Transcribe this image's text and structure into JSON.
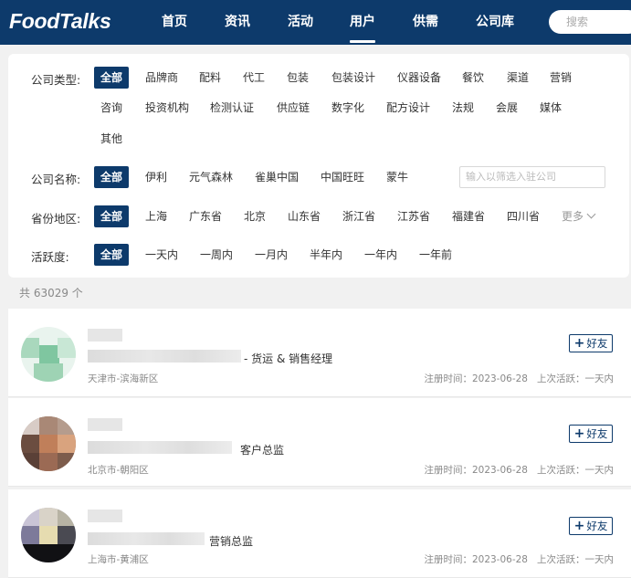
{
  "header": {
    "logo": "FoodTalks",
    "nav": [
      "首页",
      "资讯",
      "活动",
      "用户",
      "供需",
      "公司库"
    ],
    "active_nav": "用户",
    "search_placeholder": "搜索"
  },
  "filters": {
    "company_type": {
      "label": "公司类型:",
      "options": [
        "全部",
        "品牌商",
        "配料",
        "代工",
        "包装",
        "包装设计",
        "仪器设备",
        "餐饮",
        "渠道",
        "营销",
        "咨询",
        "投资机构",
        "检测认证",
        "供应链",
        "数字化",
        "配方设计",
        "法规",
        "会展",
        "媒体",
        "其他"
      ],
      "selected": "全部"
    },
    "company_name": {
      "label": "公司名称:",
      "options": [
        "全部",
        "伊利",
        "元气森林",
        "雀巢中国",
        "中国旺旺",
        "蒙牛"
      ],
      "selected": "全部",
      "input_placeholder": "输入以筛选入驻公司"
    },
    "province": {
      "label": "省份地区:",
      "options": [
        "全部",
        "上海",
        "广东省",
        "北京",
        "山东省",
        "浙江省",
        "江苏省",
        "福建省",
        "四川省"
      ],
      "selected": "全部",
      "more_label": "更多"
    },
    "activity": {
      "label": "活跃度:",
      "options": [
        "全部",
        "一天内",
        "一周内",
        "一月内",
        "半年内",
        "一年内",
        "一年前"
      ],
      "selected": "全部"
    }
  },
  "total_text": "共 63029 个",
  "users": [
    {
      "title": "- 货运 & 销售经理",
      "location": "天津市-滨海新区",
      "registered": "注册时间：2023-06-28",
      "last_active": "上次活跃：一天内",
      "friend_label": "好友"
    },
    {
      "title": "客户总监",
      "location": "北京市-朝阳区",
      "registered": "注册时间：2023-06-28",
      "last_active": "上次活跃：一天内",
      "friend_label": "好友"
    },
    {
      "title": "营销总监",
      "location": "上海市-黄浦区",
      "registered": "注册时间：2023-06-28",
      "last_active": "上次活跃：一天内",
      "friend_label": "好友"
    }
  ],
  "colors": {
    "primary": "#0d3a6b",
    "page_bg": "#f1f1f1",
    "muted_text": "#888888"
  }
}
